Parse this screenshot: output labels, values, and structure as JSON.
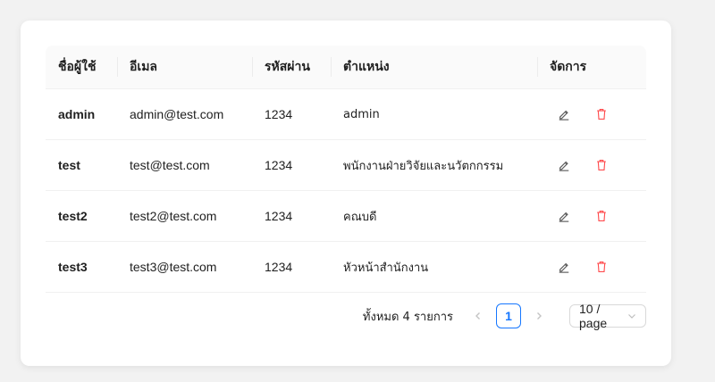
{
  "table": {
    "columns": [
      "ชื่อผู้ใช้",
      "อีเมล",
      "รหัสผ่าน",
      "ตำแหน่ง",
      "จัดการ"
    ],
    "rows": [
      {
        "username": "admin",
        "email": "admin@test.com",
        "password": "1234",
        "position": "admin"
      },
      {
        "username": "test",
        "email": "test@test.com",
        "password": "1234",
        "position": "พนักงานฝ่ายวิจัยและนวัตกกรรม"
      },
      {
        "username": "test2",
        "email": "test2@test.com",
        "password": "1234",
        "position": "คณบดี"
      },
      {
        "username": "test3",
        "email": "test3@test.com",
        "password": "1234",
        "position": "หัวหน้าสำนักงาน"
      }
    ],
    "action_icons": {
      "edit": "edit-icon",
      "delete": "delete-icon"
    }
  },
  "pagination": {
    "total_label": "ทั้งหมด 4 รายการ",
    "current_page": "1",
    "page_size_label": "10 / page",
    "prev_icon": "chevron-left-icon",
    "next_icon": "chevron-right-icon"
  },
  "colors": {
    "accent": "#1677ff",
    "delete": "#ff4d4f",
    "edit": "#595959",
    "header_bg": "#fafafa"
  }
}
